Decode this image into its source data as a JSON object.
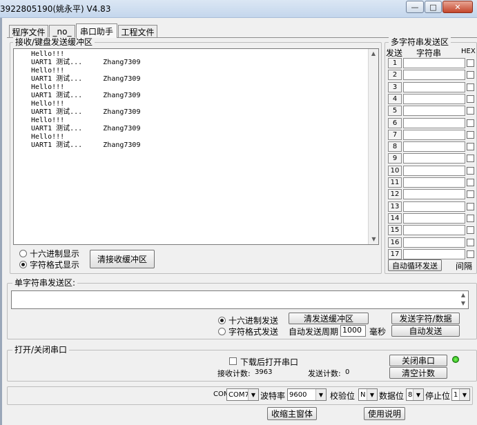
{
  "window": {
    "title": "3922805190(姚永平)  V4.83",
    "minimize": "—",
    "maximize": "□",
    "close": "✕"
  },
  "tabs": [
    {
      "label": "程序文件"
    },
    {
      "label": "_no_"
    },
    {
      "label": "串口助手"
    },
    {
      "label": "工程文件"
    }
  ],
  "receive": {
    "group_title": "接收/键盘发送缓冲区",
    "lines": [
      "Hello!!!",
      "UART1 测试...     Zhang7309",
      "Hello!!!",
      "UART1 测试...     Zhang7309",
      "Hello!!!",
      "UART1 测试...     Zhang7309",
      "Hello!!!",
      "UART1 测试...     Zhang7309",
      "Hello!!!",
      "UART1 测试...     Zhang7309",
      "Hello!!!",
      "UART1 测试...     Zhang7309"
    ],
    "hex_display": "十六进制显示",
    "text_display": "字符格式显示",
    "clear_button": "清接收缓冲区"
  },
  "multi_send": {
    "group_title": "多字符串发送区",
    "col_send": "发送",
    "col_string": "字符串",
    "col_hex": "HEX",
    "rows": [
      "1",
      "2",
      "3",
      "4",
      "5",
      "6",
      "7",
      "8",
      "9",
      "10",
      "11",
      "12",
      "13",
      "14",
      "15",
      "16",
      "17"
    ],
    "auto_loop_button": "自动循环发送",
    "interval_label": "间隔"
  },
  "single_send": {
    "group_title": "单字符串发送区:",
    "hex_send": "十六进制发送",
    "text_send": "字符格式发送",
    "clear_button": "清发送缓冲区",
    "send_button": "发送字符/数据",
    "auto_period_label": "自动发送周期",
    "period_value": "1000",
    "period_unit": "毫秒",
    "auto_send_button": "自动发送"
  },
  "port": {
    "group_title": "打开/关闭串口",
    "open_after_download": "下载后打开串口",
    "recv_count_label": "接收计数:",
    "recv_count": "3963",
    "send_count_label": "发送计数:",
    "send_count": "0",
    "close_port_button": "关闭串口",
    "clear_count_button": "清空计数"
  },
  "settings": {
    "com_label": "COM",
    "com_value": "COM7",
    "baud_label": "波特率",
    "baud_value": "9600",
    "parity_label": "校验位",
    "parity_value": "N",
    "databits_label": "数据位",
    "databits_value": "8",
    "stopbits_label": "停止位",
    "stopbits_value": "1"
  },
  "footer": {
    "shrink_button": "收缩主窗体",
    "help_button": "使用说明"
  }
}
